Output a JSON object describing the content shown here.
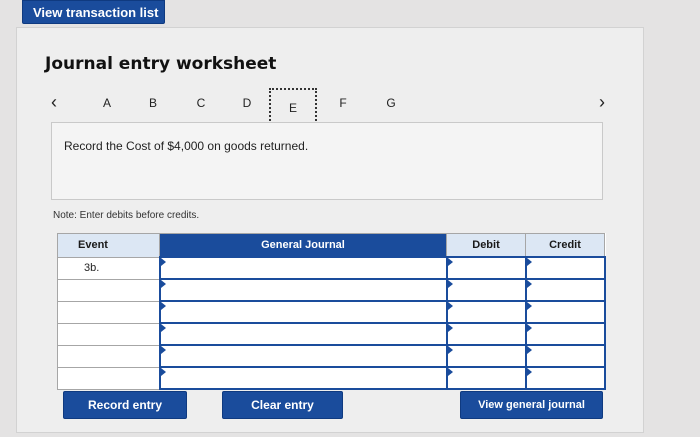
{
  "top_button": {
    "label": "View transaction list"
  },
  "worksheet": {
    "title": "Journal entry worksheet",
    "steps": [
      "A",
      "B",
      "C",
      "D",
      "E",
      "F",
      "G"
    ],
    "active_step": "E",
    "prev_icon": "chevron-left-icon",
    "next_icon": "chevron-right-icon",
    "prompt": "Record the Cost of $4,000 on goods returned.",
    "note": "Note: Enter debits before credits."
  },
  "table": {
    "headers": {
      "event": "Event",
      "general_journal": "General Journal",
      "debit": "Debit",
      "credit": "Credit"
    },
    "rows": [
      {
        "event": "3b.",
        "account": "",
        "debit": "",
        "credit": ""
      },
      {
        "event": "",
        "account": "",
        "debit": "",
        "credit": ""
      },
      {
        "event": "",
        "account": "",
        "debit": "",
        "credit": ""
      },
      {
        "event": "",
        "account": "",
        "debit": "",
        "credit": ""
      },
      {
        "event": "",
        "account": "",
        "debit": "",
        "credit": ""
      },
      {
        "event": "",
        "account": "",
        "debit": "",
        "credit": ""
      }
    ]
  },
  "buttons": {
    "record": "Record entry",
    "clear": "Clear entry",
    "view_journal": "View general journal"
  },
  "colors": {
    "accent": "#1a4c9c",
    "header_bg": "#dce7f4"
  }
}
